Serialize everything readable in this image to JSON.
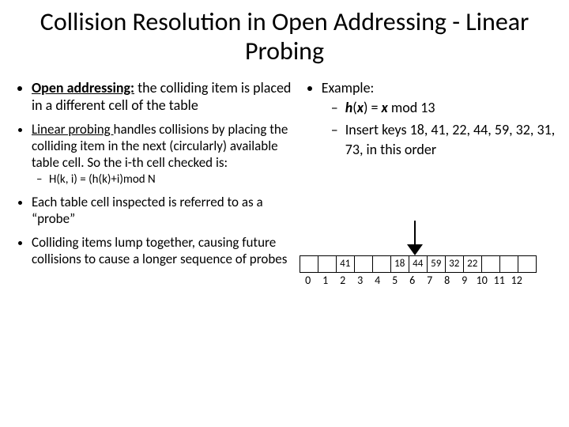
{
  "title": "Collision Resolution in Open Addressing - Linear Probing",
  "left": {
    "p1_strong_u": "Open addressing:",
    "p1_rest": " the colliding item is placed in a different cell of the table",
    "p2_u": "Linear probing ",
    "p2_rest": "handles collisions by placing the colliding item in the next (circularly) available table cell. So the i-th cell checked is:",
    "p2_sub": "H(k, i) = (h(k)+i)mod N",
    "p3": "Each table cell inspected is referred to as a “probe”",
    "p4": "Colliding items lump together, causing future collisions to cause a longer sequence of probes"
  },
  "right": {
    "head": "Example:",
    "eq_h": "h",
    "eq_x1": "(",
    "eq_x2": "x",
    "eq_x3": ") = ",
    "eq_x4": "x",
    "eq_tail": " mod 13",
    "ins": "Insert keys 18, 41, 22, 44, 59, 32, 31, 73, in this order"
  },
  "table": {
    "cells": [
      "",
      "",
      "41",
      "",
      "",
      "18",
      "44",
      "59",
      "32",
      "22",
      "",
      "",
      ""
    ],
    "indices": [
      "0",
      "1",
      "2",
      "3",
      "4",
      "5",
      "6",
      "7",
      "8",
      "9",
      "10",
      "11",
      "12"
    ]
  },
  "chart_data": {
    "type": "table",
    "title": "Hash table after linear-probing inserts (h(x) = x mod 13)",
    "indices": [
      0,
      1,
      2,
      3,
      4,
      5,
      6,
      7,
      8,
      9,
      10,
      11,
      12
    ],
    "values": [
      null,
      null,
      41,
      null,
      null,
      18,
      44,
      59,
      32,
      22,
      null,
      null,
      null
    ],
    "insert_order": [
      18,
      41,
      22,
      44,
      59,
      32,
      31,
      73
    ],
    "modulus": 13
  }
}
